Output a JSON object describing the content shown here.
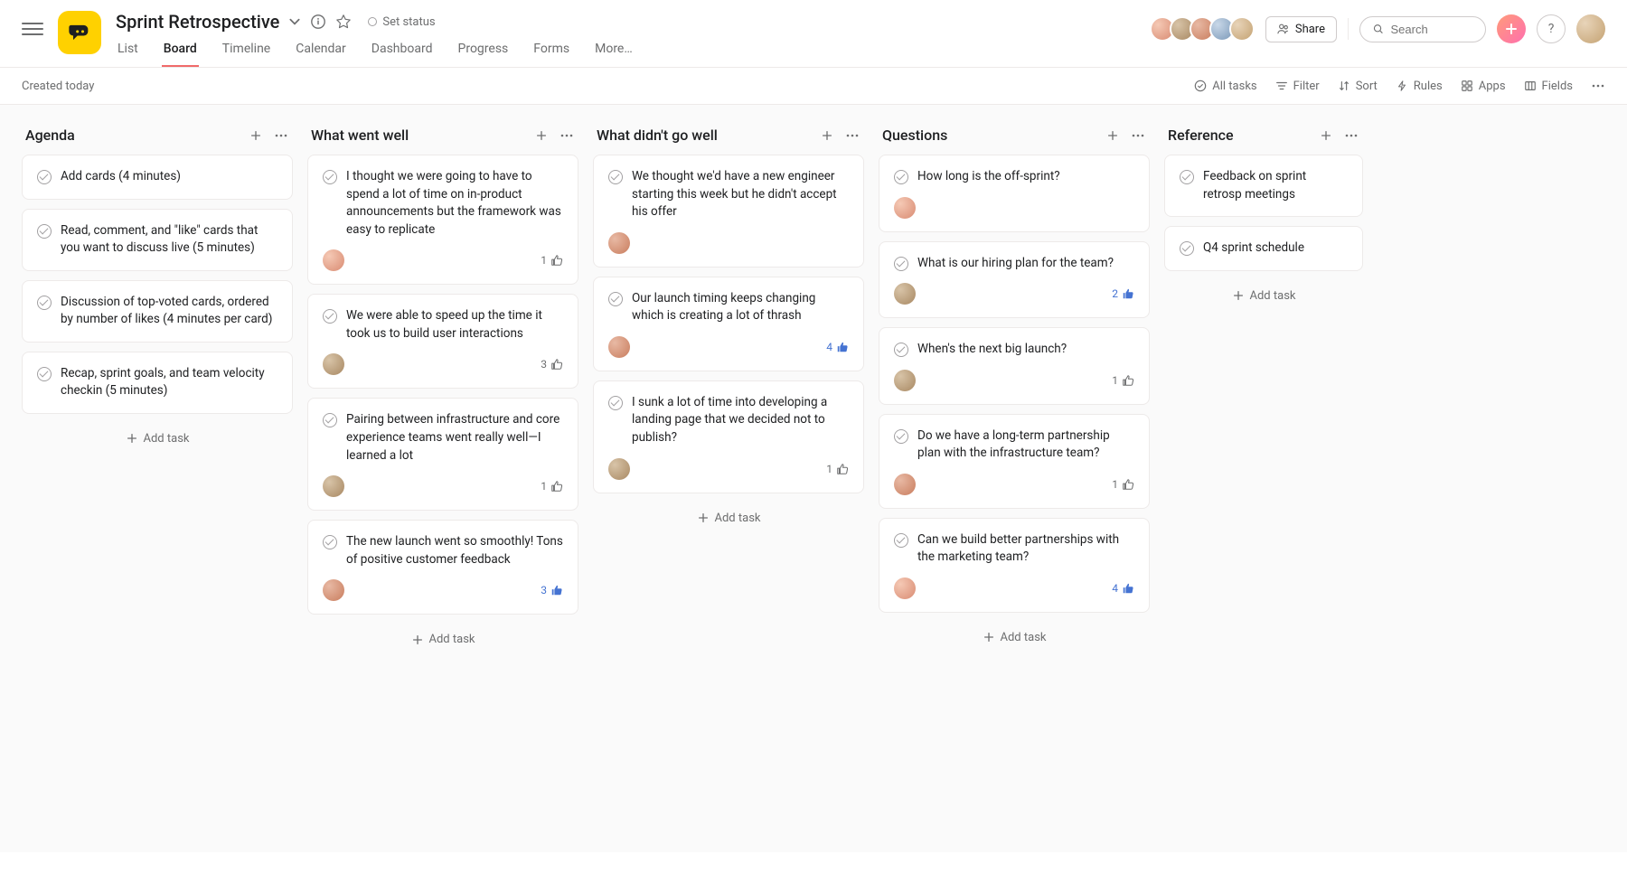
{
  "project": {
    "title": "Sprint Retrospective",
    "set_status_label": "Set status"
  },
  "tabs": [
    "List",
    "Board",
    "Timeline",
    "Calendar",
    "Dashboard",
    "Progress",
    "Forms",
    "More…"
  ],
  "active_tab": "Board",
  "header": {
    "share_label": "Share",
    "search_placeholder": "Search"
  },
  "toolbar": {
    "created_label": "Created today",
    "buttons": {
      "all_tasks": "All tasks",
      "filter": "Filter",
      "sort": "Sort",
      "rules": "Rules",
      "apps": "Apps",
      "fields": "Fields"
    }
  },
  "add_task_label": "Add task",
  "columns": [
    {
      "title": "Agenda",
      "cards": [
        {
          "text": "Add cards (4 minutes)",
          "avatar": null,
          "likes": null,
          "liked": false
        },
        {
          "text": "Read, comment, and \"like\" cards that you want to discuss live (5 minutes)",
          "avatar": null,
          "likes": null,
          "liked": false
        },
        {
          "text": "Discussion of top-voted cards, ordered by number of likes (4 minutes per card)",
          "avatar": null,
          "likes": null,
          "liked": false
        },
        {
          "text": "Recap, sprint goals, and team velocity checkin (5 minutes)",
          "avatar": null,
          "likes": null,
          "liked": false
        }
      ]
    },
    {
      "title": "What went well",
      "cards": [
        {
          "text": "I thought we were going to have to spend a lot of time on in-product announcements but the framework was easy to replicate",
          "avatar": "av-a",
          "likes": 1,
          "liked": false
        },
        {
          "text": "We were able to speed up the time it took us to build user interactions",
          "avatar": "av-b",
          "likes": 3,
          "liked": false
        },
        {
          "text": "Pairing between infrastructure and core experience teams went really well—I learned a lot",
          "avatar": "av-b",
          "likes": 1,
          "liked": false
        },
        {
          "text": "The new launch went so smoothly! Tons of positive customer feedback",
          "avatar": "av-c",
          "likes": 3,
          "liked": true
        }
      ]
    },
    {
      "title": "What didn't go well",
      "cards": [
        {
          "text": "We thought we'd have a new engineer starting this week but he didn't accept his offer",
          "avatar": "av-c",
          "likes": null,
          "liked": false
        },
        {
          "text": "Our launch timing keeps changing which is creating a lot of thrash",
          "avatar": "av-c",
          "likes": 4,
          "liked": true
        },
        {
          "text": "I sunk a lot of time into developing a landing page that we decided not to publish?",
          "avatar": "av-b",
          "likes": 1,
          "liked": false
        }
      ]
    },
    {
      "title": "Questions",
      "cards": [
        {
          "text": "How long is the off-sprint?",
          "avatar": "av-a",
          "likes": null,
          "liked": false
        },
        {
          "text": "What is our hiring plan for the team?",
          "avatar": "av-b",
          "likes": 2,
          "liked": true
        },
        {
          "text": "When's the next big launch?",
          "avatar": "av-b",
          "likes": 1,
          "liked": false
        },
        {
          "text": "Do we have a long-term partnership plan with the infrastructure team?",
          "avatar": "av-c",
          "likes": 1,
          "liked": false
        },
        {
          "text": "Can we build better partnerships with the marketing team?",
          "avatar": "av-a",
          "likes": 4,
          "liked": true
        }
      ]
    },
    {
      "title": "Reference",
      "cards": [
        {
          "text": "Feedback on sprint retrosp meetings",
          "avatar": null,
          "likes": null,
          "liked": false
        },
        {
          "text": "Q4 sprint schedule",
          "avatar": null,
          "likes": null,
          "liked": false
        }
      ]
    }
  ]
}
